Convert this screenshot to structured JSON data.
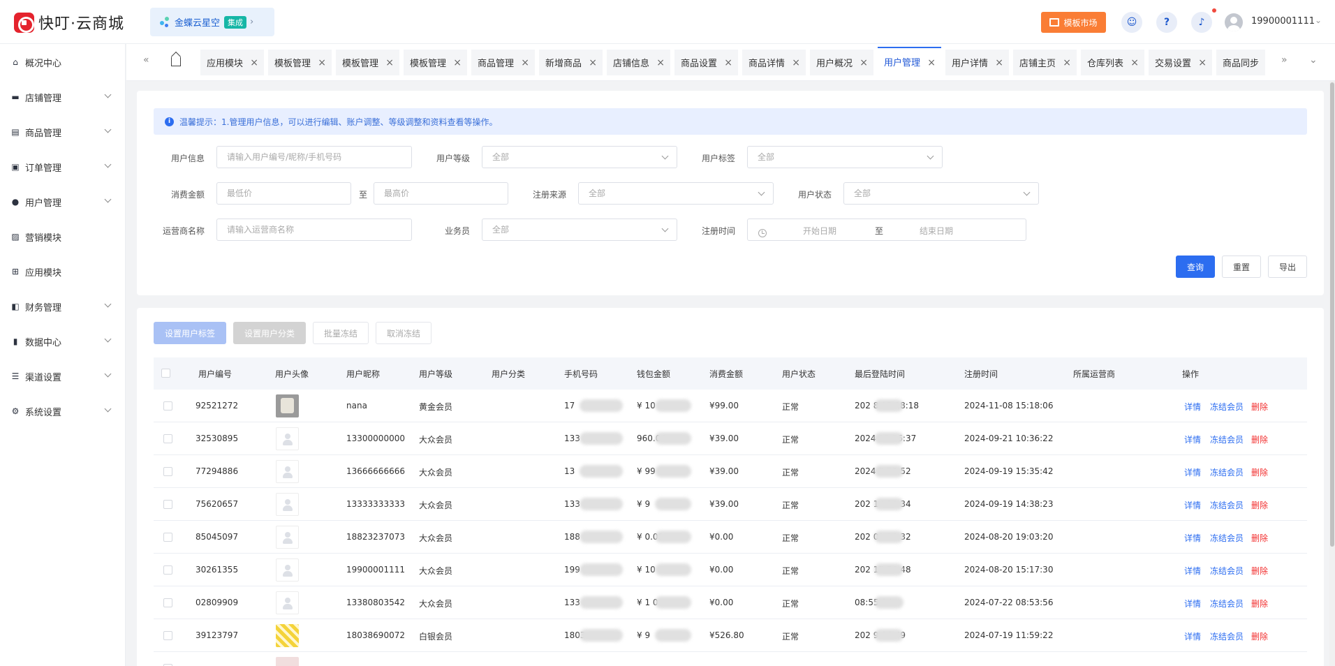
{
  "app": {
    "title": "快叮·云商城",
    "store_name": "金蝶云星空",
    "store_badge": "集成",
    "template_market": "模板市场",
    "user_phone": "19900001111"
  },
  "sidebar": {
    "items": [
      {
        "label": "概况中心",
        "icon": "home-icon",
        "expandable": false
      },
      {
        "label": "店铺管理",
        "icon": "shop-icon",
        "expandable": true
      },
      {
        "label": "商品管理",
        "icon": "goods-icon",
        "expandable": true
      },
      {
        "label": "订单管理",
        "icon": "order-icon",
        "expandable": true
      },
      {
        "label": "用户管理",
        "icon": "user-icon",
        "expandable": true
      },
      {
        "label": "营销模块",
        "icon": "marketing-icon",
        "expandable": false
      },
      {
        "label": "应用模块",
        "icon": "apps-grid-icon",
        "expandable": false
      },
      {
        "label": "财务管理",
        "icon": "finance-icon",
        "expandable": true
      },
      {
        "label": "数据中心",
        "icon": "chart-icon",
        "expandable": true
      },
      {
        "label": "渠道设置",
        "icon": "channel-icon",
        "expandable": true
      },
      {
        "label": "系统设置",
        "icon": "gear-icon",
        "expandable": true
      }
    ]
  },
  "tabs": [
    {
      "label": "应用模块",
      "active": false
    },
    {
      "label": "模板管理",
      "active": false
    },
    {
      "label": "模板管理",
      "active": false
    },
    {
      "label": "模板管理",
      "active": false
    },
    {
      "label": "商品管理",
      "active": false
    },
    {
      "label": "新增商品",
      "active": false
    },
    {
      "label": "店铺信息",
      "active": false
    },
    {
      "label": "商品设置",
      "active": false
    },
    {
      "label": "商品详情",
      "active": false
    },
    {
      "label": "用户概况",
      "active": false
    },
    {
      "label": "用户管理",
      "active": true
    },
    {
      "label": "用户详情",
      "active": false
    },
    {
      "label": "店铺主页",
      "active": false
    },
    {
      "label": "仓库列表",
      "active": false
    },
    {
      "label": "交易设置",
      "active": false
    },
    {
      "label": "商品同步",
      "active": false
    }
  ],
  "tip": "温馨提示：1.管理用户信息，可以进行编辑、账户调整、等级调整和资料查看等操作。",
  "filters": {
    "user_info": {
      "label": "用户信息",
      "placeholder": "请输入用户编号/昵称/手机号码"
    },
    "user_level": {
      "label": "用户等级",
      "value": "全部"
    },
    "user_tag": {
      "label": "用户标签",
      "value": "全部"
    },
    "spend": {
      "label": "消费金额",
      "min_placeholder": "最低价",
      "to": "至",
      "max_placeholder": "最高价"
    },
    "reg_source": {
      "label": "注册来源",
      "value": "全部"
    },
    "user_status": {
      "label": "用户状态",
      "value": "全部"
    },
    "operator": {
      "label": "运营商名称",
      "placeholder": "请输入运营商名称"
    },
    "salesman": {
      "label": "业务员",
      "value": "全部"
    },
    "reg_time": {
      "label": "注册时间",
      "start": "开始日期",
      "to": "至",
      "end": "结束日期"
    }
  },
  "buttons": {
    "query": "查询",
    "reset": "重置",
    "export": "导出"
  },
  "actions": {
    "set_tag": "设置用户标签",
    "set_category": "设置用户分类",
    "batch_freeze": "批量冻结",
    "unfreeze": "取消冻结"
  },
  "table": {
    "columns": [
      "用户编号",
      "用户头像",
      "用户昵称",
      "用户等级",
      "用户分类",
      "手机号码",
      "钱包金额",
      "消费金额",
      "用户状态",
      "最后登陆时间",
      "注册时间",
      "所属运营商",
      "操作"
    ],
    "ops": {
      "detail": "详情",
      "freeze": "冻结会员",
      "delete": "删除"
    },
    "rows": [
      {
        "id": "92521272",
        "avatar": "photo",
        "nickname": "nana",
        "level": "黄金会员",
        "phone": "17",
        "wallet": "¥ 10",
        "spend": "¥99.00",
        "status": "正常",
        "last_login": "202          8 15:18:18",
        "reg_time": "2024-11-08 15:18:06"
      },
      {
        "id": "32530895",
        "avatar": "placeholder",
        "nickname": "13300000000",
        "level": "大众会员",
        "phone": "133",
        "wallet": "960.00",
        "spend": "¥39.00",
        "status": "正常",
        "last_login": "2024          10:36:37",
        "reg_time": "2024-09-21 10:36:22"
      },
      {
        "id": "77294886",
        "avatar": "placeholder",
        "nickname": "13666666666",
        "level": "大众会员",
        "phone": "13",
        "wallet": "¥ 99",
        "spend": "¥39.00",
        "status": "正常",
        "last_login": "2024          5:35:52",
        "reg_time": "2024-09-19 15:35:42"
      },
      {
        "id": "75620657",
        "avatar": "placeholder",
        "nickname": "13333333333",
        "level": "大众会员",
        "phone": "133",
        "wallet": "¥ 9",
        "spend": "¥39.00",
        "status": "正常",
        "last_login": "202          14:38:34",
        "reg_time": "2024-09-19 14:38:23"
      },
      {
        "id": "85045097",
        "avatar": "placeholder",
        "nickname": "18823237073",
        "level": "大众会员",
        "phone": "188",
        "wallet": "¥ 0.00",
        "spend": "¥0.00",
        "status": "正常",
        "last_login": "202          09:28:32",
        "reg_time": "2024-08-20 19:03:20"
      },
      {
        "id": "30261355",
        "avatar": "placeholder",
        "nickname": "19900001111",
        "level": "大众会员",
        "phone": "199",
        "wallet": "¥ 10",
        "spend": "¥0.00",
        "status": "正常",
        "last_login": "202          17:58:48",
        "reg_time": "2024-08-20 15:17:30"
      },
      {
        "id": "02809909",
        "avatar": "placeholder",
        "nickname": "13380803542",
        "level": "大众会员",
        "phone": "133",
        "wallet": "¥ 1          0",
        "spend": "¥0.00",
        "status": "正常",
        "last_login": "          08:55:24",
        "reg_time": "2024-07-22 08:53:56"
      },
      {
        "id": "39123797",
        "avatar": "stripes",
        "nickname": "18038690072",
        "level": "白银会员",
        "phone": "1803",
        "wallet": "¥ 9",
        "spend": "¥526.80",
        "status": "正常",
        "last_login": "202          9:36:49",
        "reg_time": "2024-07-19 11:59:22"
      },
      {
        "id": "",
        "avatar": "pinkish",
        "nickname": "",
        "level": "",
        "phone": "",
        "wallet": "",
        "spend": "",
        "status": "",
        "last_login": "",
        "reg_time": ""
      }
    ]
  }
}
